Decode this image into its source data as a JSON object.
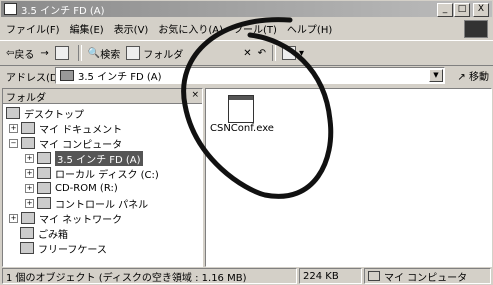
{
  "window": {
    "title": "3.5 インチ FD (A)"
  },
  "title_buttons": {
    "minimize": "_",
    "maximize": "□",
    "close": "X"
  },
  "menu": [
    "ファイル(F)",
    "編集(E)",
    "表示(V)",
    "お気に入り(A)",
    "ツール(T)",
    "ヘルプ(H)"
  ],
  "toolbar": {
    "back": "戻る",
    "forward": "→",
    "search": "検索",
    "folders": "フォルダ",
    "undo": "↶"
  },
  "address": {
    "label": "アドレス(D)",
    "value": "3.5 インチ FD (A)",
    "go": "移動"
  },
  "folder_pane": {
    "header": "フォルダ",
    "close": "×",
    "items": [
      {
        "label": "デスクトップ"
      },
      {
        "label": "マイ ドキュメント"
      },
      {
        "label": "マイ コンピュータ"
      },
      {
        "label": "3.5 インチ FD (A)"
      },
      {
        "label": "ローカル ディスク (C:)"
      },
      {
        "label": "CD-ROM (R:)"
      },
      {
        "label": "コントロール パネル"
      },
      {
        "label": "マイ ネットワーク"
      },
      {
        "label": "ごみ箱"
      },
      {
        "label": "フリーフケース"
      }
    ]
  },
  "files": [
    {
      "name": "CSNConf.exe"
    }
  ],
  "status": {
    "objects": "1 個のオブジェクト (ディスクの空き領域 : 1.16 MB)",
    "size": "224 KB",
    "location": "マイ コンピュータ"
  }
}
